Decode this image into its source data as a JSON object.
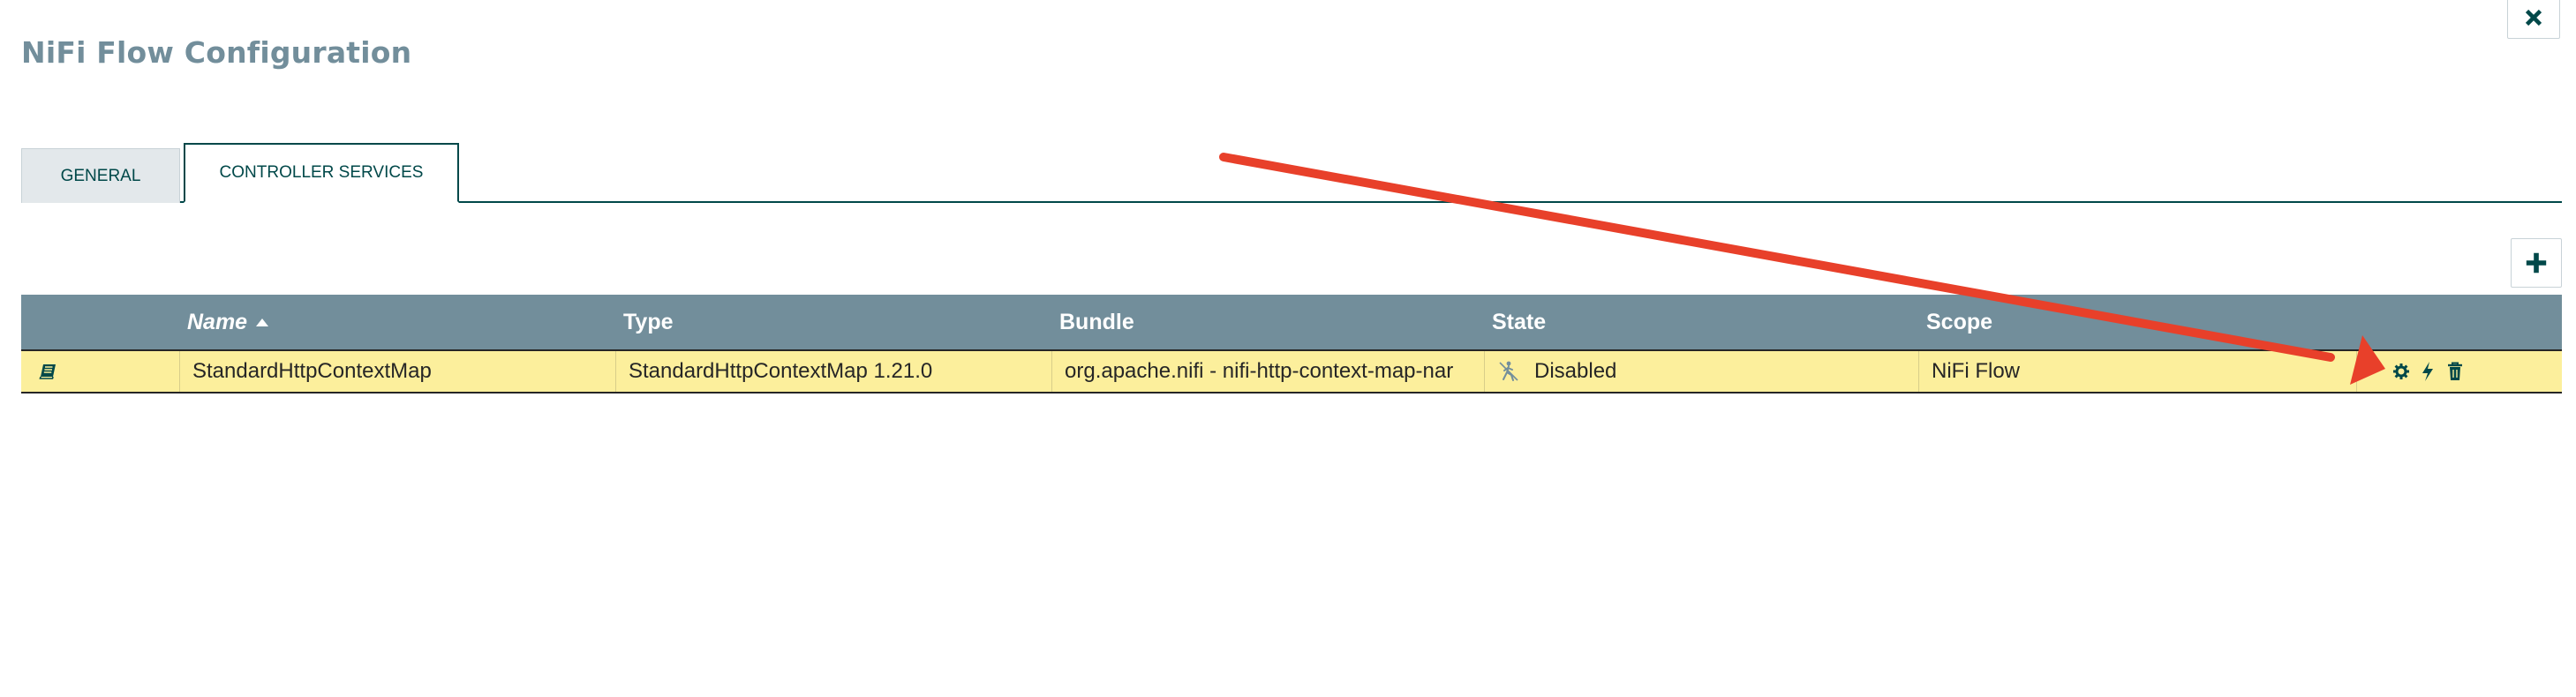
{
  "dialog": {
    "title": "NiFi Flow Configuration"
  },
  "tabs": [
    {
      "label": "General",
      "active": false
    },
    {
      "label": "Controller Services",
      "active": true
    }
  ],
  "table": {
    "columns": [
      "Name",
      "Type",
      "Bundle",
      "State",
      "Scope"
    ],
    "sorted_column": "Name",
    "sort_direction": "ascending",
    "rows": [
      {
        "name": "StandardHttpContextMap",
        "type": "StandardHttpContextMap 1.21.0",
        "bundle": "org.apache.nifi - nifi-http-context-map-nar",
        "state": "Disabled",
        "scope": "NiFi Flow",
        "actions": [
          "configure-icon",
          "enable-icon",
          "delete-icon"
        ]
      }
    ]
  },
  "colors": {
    "title": "#728e9b",
    "header_bg": "#728e9b",
    "row_highlight": "#fcef9c",
    "accent": "#004849",
    "annotation_arrow": "#e8402a"
  },
  "annotation": {
    "type": "arrow",
    "color": "#e8402a",
    "points_to": "row-actions"
  }
}
